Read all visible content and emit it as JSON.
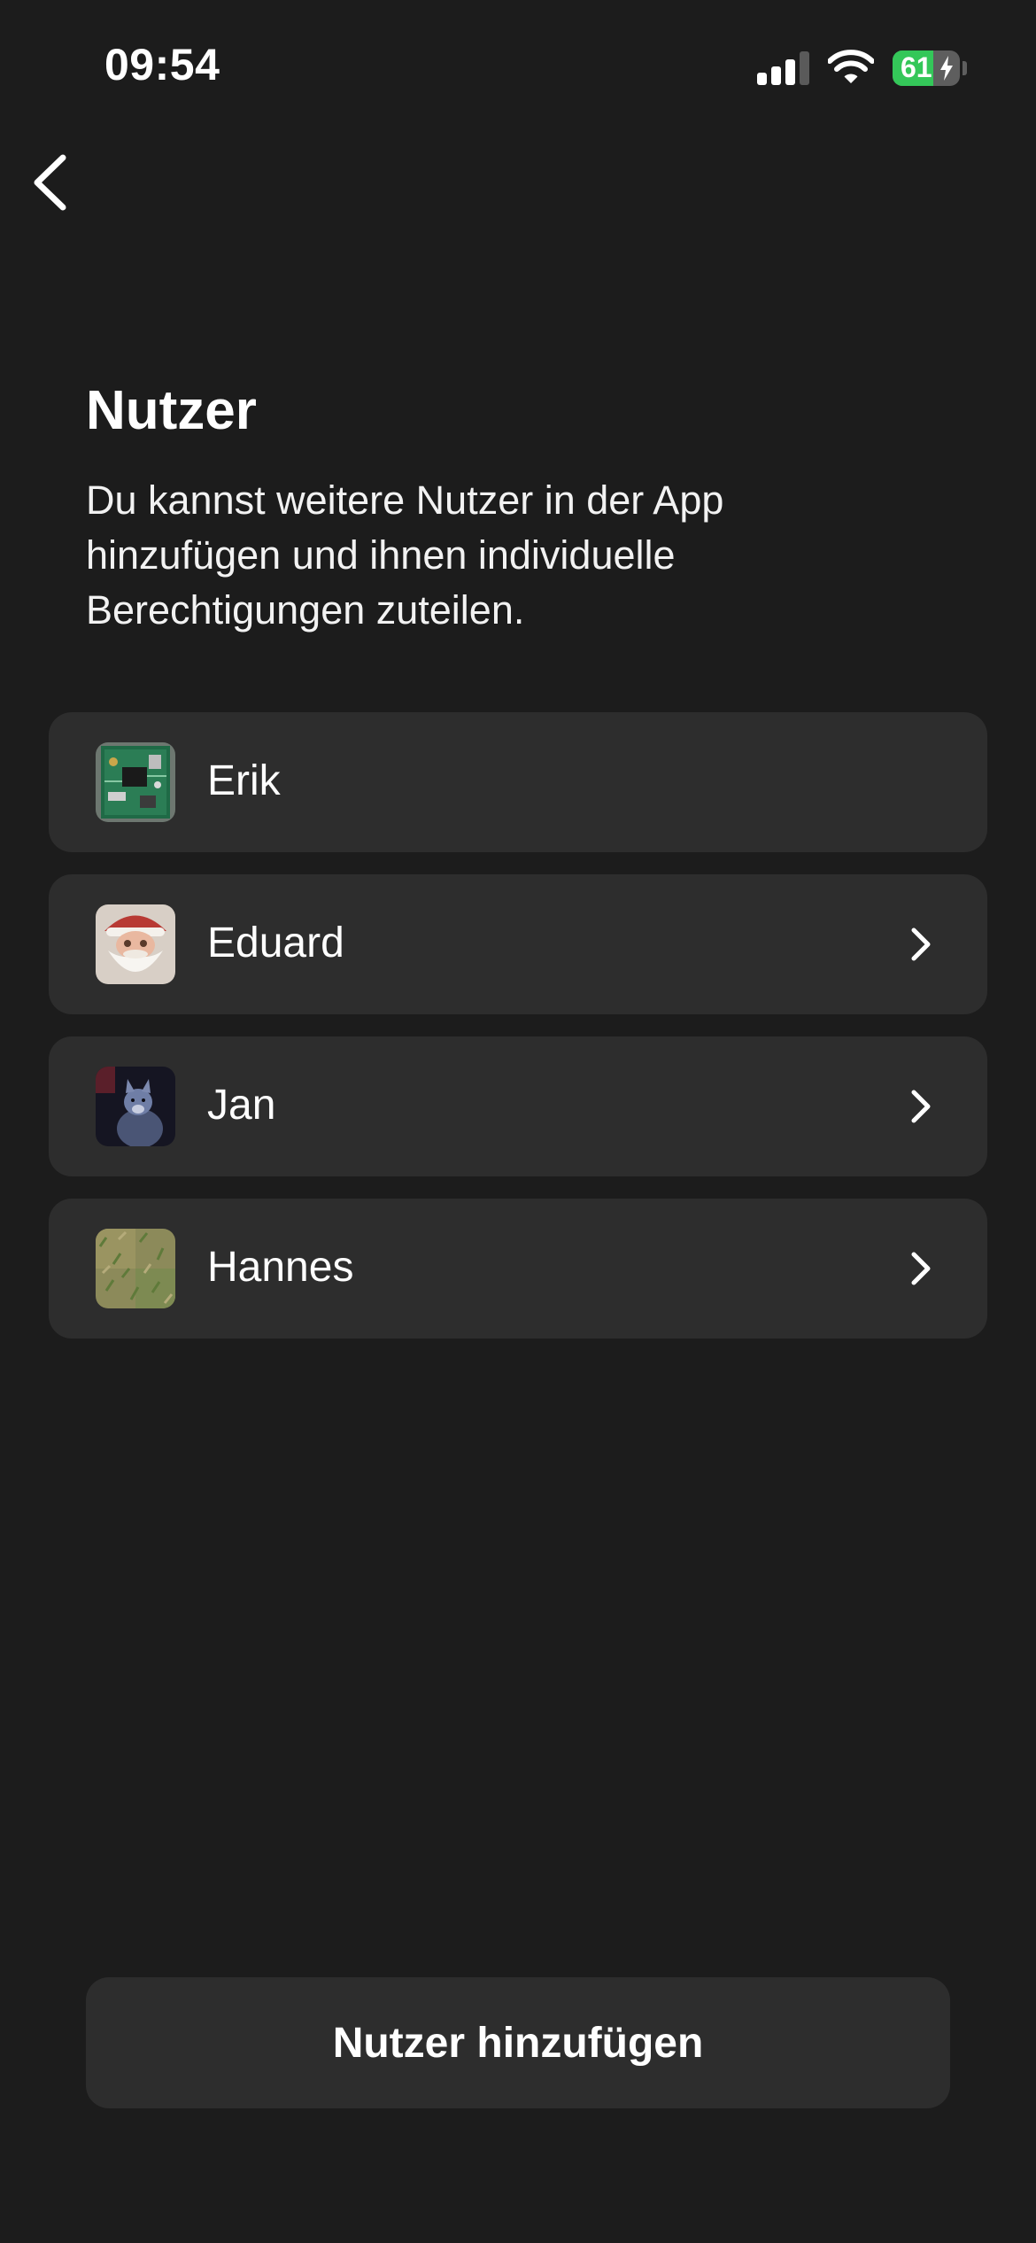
{
  "status_bar": {
    "time": "09:54",
    "battery_level": "61",
    "battery_fill_fraction": 0.61,
    "signal_icon": "cellular-signal-icon",
    "wifi_icon": "wifi-icon",
    "battery_icon": "battery-charging-icon"
  },
  "nav": {
    "back_icon": "chevron-left-icon"
  },
  "header": {
    "title": "Nutzer",
    "description": "Du kannst weitere Nutzer in der App hinzufügen und ihnen individuelle Berechtigungen zuteilen."
  },
  "users": [
    {
      "name": "Erik",
      "avatar": "circuit-board-photo",
      "has_chevron": false
    },
    {
      "name": "Eduard",
      "avatar": "santa-claus-photo",
      "has_chevron": true
    },
    {
      "name": "Jan",
      "avatar": "dog-photo",
      "has_chevron": true
    },
    {
      "name": "Hannes",
      "avatar": "grass-photo",
      "has_chevron": true
    }
  ],
  "actions": {
    "add_user_label": "Nutzer hinzufügen"
  },
  "colors": {
    "background": "#1c1c1c",
    "card": "#2d2d2d",
    "text": "#ffffff",
    "battery_green": "#34c759"
  }
}
